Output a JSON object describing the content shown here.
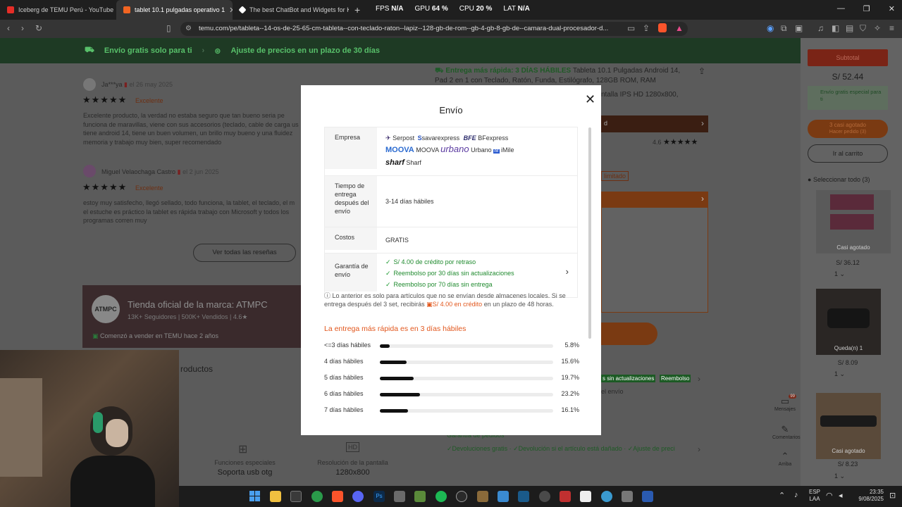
{
  "browser": {
    "tabs": [
      {
        "title": "Iceberg de TEMU Perú - YouTube",
        "color": "#e52d27"
      },
      {
        "title": "tablet 10.1 pulgadas operativo 1",
        "color": "#f26522"
      },
      {
        "title": "The best ChatBot and Widgets for Ki",
        "color": "#ffffff"
      }
    ],
    "perf": [
      {
        "label": "FPS",
        "value": "N/A"
      },
      {
        "label": "GPU",
        "value": "64 %"
      },
      {
        "label": "CPU",
        "value": "20 %"
      },
      {
        "label": "LAT",
        "value": "N/A"
      }
    ],
    "url": "temu.com/pe/tableta--14-os-de-25-65-cm-tableta--con-teclado-raton--lapiz--128-gb-de-rom--gb-4-gb-8-gb-de--camara-dual-procesador-d..."
  },
  "banner": {
    "free_shipping": "Envío gratis solo para ti",
    "price_adjust": "Ajuste de precios en un plazo de 30 días"
  },
  "reviews": [
    {
      "user": "Ja***ya",
      "date": "el 26 may 2025",
      "rating_label": "Excelente",
      "text": "Excelente producto, la verdad no estaba seguro que tan bueno seria pe funciona de maravillas, viene con sus accesorios (teclado, cable de carga us tiene android 14, tiene un buen volumen, un brillo muy bueno y una fluidez memoria y trabajo muy bien, super recomendado"
    },
    {
      "user": "Miguel Velaochaga Castro",
      "date": "el 2 jun 2025",
      "rating_label": "Excelente",
      "text": "estoy muy satisfecho, llegó sellado, todo funciona, la tablet, el teclado, el m el estuche es práctico la tablet es rápida trabajo con Microsoft y todos los programas corren muy"
    }
  ],
  "see_all_reviews": "Ver todas las reseñas",
  "store": {
    "name": "Tienda oficial de la marca: ATMPC",
    "logo": "ATMPC",
    "followers": "13K+ Seguidores",
    "sold": "500K+ Vendidos",
    "rating": "4.6★",
    "since": "Comenzó a vender en TEMU hace 2 años"
  },
  "products_heading": "roductos",
  "product": {
    "fast_delivery": "Entrega más rápida: 3 DÍAS HÁBILES",
    "title": "Tableta 10.1 Pulgadas Android 14, Pad 2 en 1 con Teclado, Ratón, Funda, Estilógrafo, 128GB ROM, RAM",
    "title2": "ntalla IPS HD 1280x800,",
    "rating": "4.6",
    "limited": "limitado",
    "guarantee": "Garantía de pedidos",
    "guarantee_items": "✓Devoluciones gratis · ✓Devolución si el artículo está dañado · ✓Ajuste de preci",
    "badges": [
      "s sin actualizaciones",
      "Reembolso"
    ],
    "envio_short": "el envío"
  },
  "specs": [
    {
      "label": "Funciones especiales",
      "value": "Soporta usb otg"
    },
    {
      "label": "Resolución de la pantalla",
      "value": "1280x800"
    }
  ],
  "cart": {
    "subtotal_label": "Subtotal",
    "subtotal": "S/ 52.44",
    "free_ship": "Envío gratis especial para ti",
    "almost_sold": "3 casi agotado",
    "order_now": "Hacer pedido (3)",
    "go_cart": "Ir al carrito",
    "select_all": "Seleccionar todo (3)",
    "items": [
      {
        "badge": "Casi agotado",
        "price": "S/ 36.12",
        "qty": "1"
      },
      {
        "badge": "Queda(n) 1",
        "price": "S/ 8.09",
        "qty": "1"
      },
      {
        "badge": "Casi agotado",
        "price": "S/ 8.23",
        "qty": "1"
      }
    ],
    "side": [
      {
        "label": "Mensajes",
        "badge": "99"
      },
      {
        "label": "Comentarios"
      },
      {
        "label": "Arriba"
      }
    ]
  },
  "modal": {
    "title": "Envío",
    "rows": {
      "empresa_label": "Empresa",
      "carriers": [
        {
          "logo": "",
          "name": "Serpost"
        },
        {
          "logo": "",
          "name": "savarexpress"
        },
        {
          "logo": "BFE",
          "name": "BFexpress"
        },
        {
          "logo": "MOOVA",
          "name": "MOOVA"
        },
        {
          "logo": "urbano",
          "name": "Urbano"
        },
        {
          "logo": "",
          "name": "iMile"
        },
        {
          "logo": "sharf",
          "name": "Sharf"
        }
      ],
      "tiempo_label": "Tiempo de entrega después del envío",
      "tiempo_value": "3-14 días hábiles",
      "costos_label": "Costos",
      "costos_value": "GRATIS",
      "garantia_label": "Garantía de envío",
      "garantia_items": [
        "S/ 4.00 de crédito por retraso",
        "Reembolso por 30 días sin actualizaciones",
        "Reembolso por 70 días sin entrega"
      ]
    },
    "note_a": "ⓘ Lo anterior es solo para artículos que no se envían desde almacenes locales. Si se entrega después del 3 set, recibirás",
    "note_credit": "S/ 4.00 en crédito",
    "note_b": "en un plazo de 48 horas.",
    "fastest_title": "La entrega más rápida es en 3 días hábiles",
    "distribution": [
      {
        "label": "<=3 días hábiles",
        "pct": 5.8,
        "pct_text": "5.8%"
      },
      {
        "label": "4 días hábiles",
        "pct": 15.6,
        "pct_text": "15.6%"
      },
      {
        "label": "5 días hábiles",
        "pct": 19.7,
        "pct_text": "19.7%"
      },
      {
        "label": "6 días hábiles",
        "pct": 23.2,
        "pct_text": "23.2%"
      },
      {
        "label": "7 días hábiles",
        "pct": 16.1,
        "pct_text": "16.1%"
      }
    ]
  },
  "taskbar": {
    "lang": "ESP",
    "lang2": "LAA",
    "time": "23:35",
    "date": "9/08/2025"
  },
  "colors": {
    "temu_orange": "#e2571d",
    "green": "#1f9b32",
    "banner_green": "#1e3a24"
  }
}
